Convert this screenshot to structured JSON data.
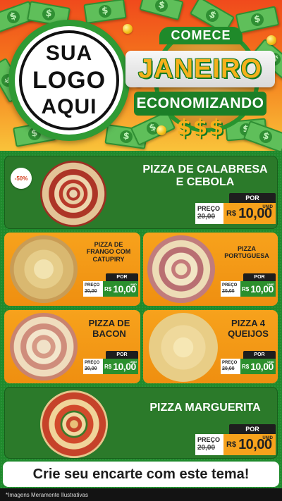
{
  "header": {
    "logo_lines": [
      "SUA",
      "LOGO",
      "AQUI"
    ],
    "comece": "COMECE",
    "janeiro": "JANEIRO",
    "economizando": "ECONOMIZANDO",
    "dollars": "$$$"
  },
  "featured": {
    "discount_badge": "-50%",
    "title_line1": "PIZZA DE CALABRESA",
    "title_line2": "E CEBOLA",
    "por": "POR",
    "preco": "PREÇO",
    "old_price": "20,00",
    "currency": "R$",
    "new_price": "10,00",
    "unid": "UNID"
  },
  "cards": [
    {
      "title": [
        "PIZZA DE",
        "FRANGO COM",
        "CATUPIRY"
      ],
      "por": "POR",
      "preco": "PREÇO",
      "old_price": "20,00",
      "currency": "R$",
      "new_price": "10,00",
      "unid": "UNID"
    },
    {
      "title": [
        "PIZZA",
        "PORTUGUESA"
      ],
      "por": "POR",
      "preco": "PREÇO",
      "old_price": "20,00",
      "currency": "R$",
      "new_price": "10,00",
      "unid": "UNID"
    },
    {
      "title": [
        "PIZZA DE",
        "BACON"
      ],
      "por": "POR",
      "preco": "PREÇO",
      "old_price": "20,00",
      "currency": "R$",
      "new_price": "10,00",
      "unid": "UNID"
    },
    {
      "title": [
        "PIZZA 4",
        "QUEIJOS"
      ],
      "por": "POR",
      "preco": "PREÇO",
      "old_price": "20,00",
      "currency": "R$",
      "new_price": "10,00",
      "unid": "UNID"
    }
  ],
  "bottom_featured": {
    "title": "PIZZA MARGUERITA",
    "por": "POR",
    "preco": "PREÇO",
    "old_price": "20,00",
    "currency": "R$",
    "new_price": "10,00",
    "unid": "UNID"
  },
  "banner": "Crie seu encarte com este tema!",
  "footer": "*Imagens Meramente Ilustrativas"
}
